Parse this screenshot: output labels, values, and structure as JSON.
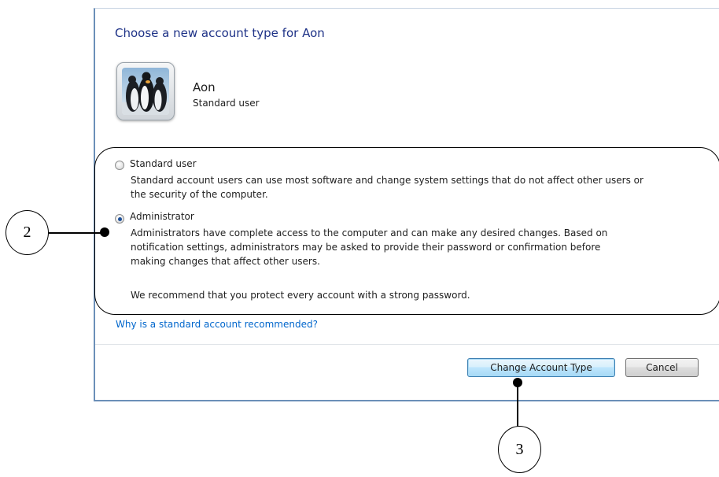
{
  "dialog": {
    "title": "Choose a new account type for Aon",
    "user": {
      "name": "Aon",
      "type": "Standard user"
    }
  },
  "options": [
    {
      "label": "Standard user",
      "selected": false,
      "description": [
        "Standard account users can use most software and change system settings that do not affect other users or",
        "the security of the computer."
      ]
    },
    {
      "label": "Administrator",
      "selected": true,
      "description": [
        "Administrators have complete access to the computer and can make any desired changes. Based on",
        "notification settings, administrators may be asked to provide their password or confirmation before",
        "making changes that affect other users."
      ]
    }
  ],
  "recommendation": "We recommend that you protect every account with a strong password.",
  "link_text": "Why is a standard account recommended?",
  "buttons": {
    "primary": "Change Account Type",
    "cancel": "Cancel"
  },
  "annotations": {
    "options_marker": "2",
    "button_marker": "3"
  },
  "icons": {
    "user_picture": "penguins-avatar-icon"
  },
  "colors": {
    "title": "#1e3287",
    "link": "#0066cc",
    "window_border": "#6b8fb8",
    "annotation": "#000000"
  }
}
